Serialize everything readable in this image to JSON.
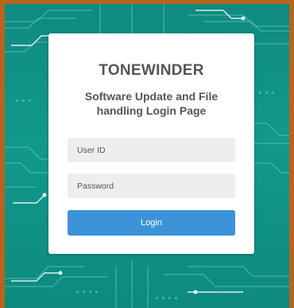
{
  "brand": "TONEWINDER",
  "subtitle_line1": "Software Update and File",
  "subtitle_line2": "handling Login Page",
  "user_id": {
    "placeholder": "User ID",
    "value": ""
  },
  "password": {
    "placeholder": "Password",
    "value": ""
  },
  "login_label": "Login",
  "colors": {
    "frame": "#b8641f",
    "background": "#0f8a80",
    "card": "#ffffff",
    "button": "#3d93d9",
    "input": "#eeeeee"
  }
}
